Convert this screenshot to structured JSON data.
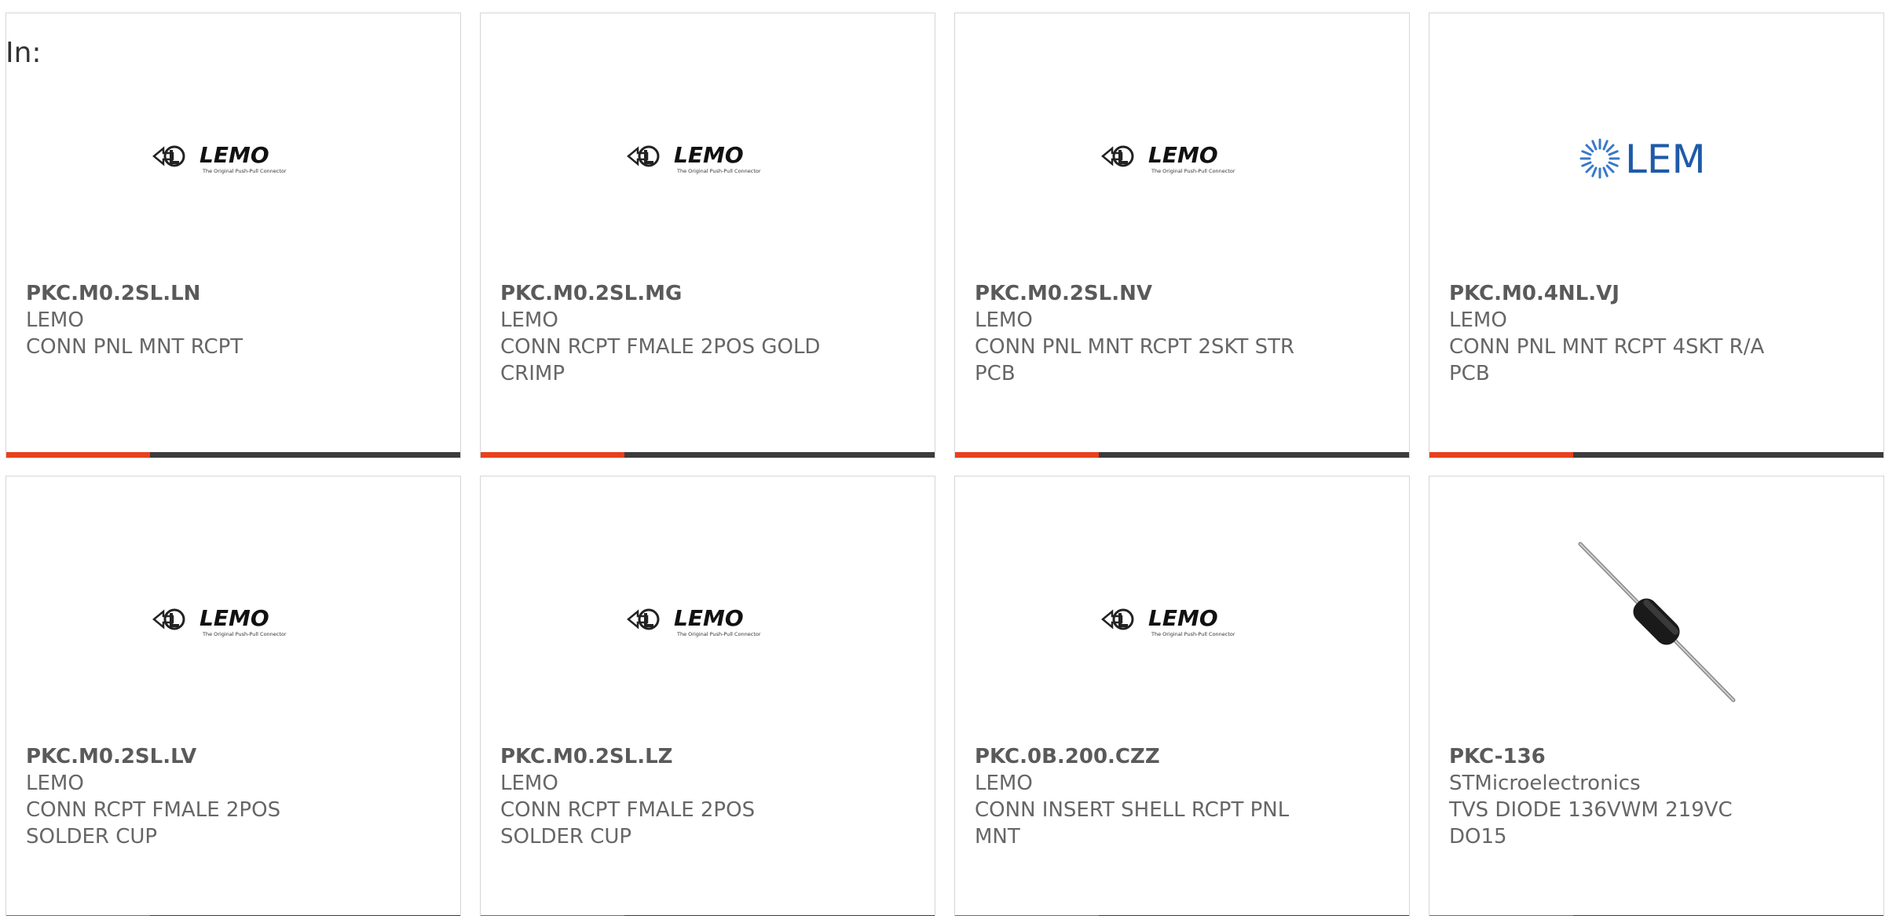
{
  "header": {
    "label": "In:"
  },
  "cards": [
    {
      "part": "PKC.M0.2SL.LN",
      "manufacturer": "LEMO",
      "description": "CONN PNL MNT RCPT",
      "description2": "",
      "image": "lemo-logo",
      "logo_text": "LEMO",
      "logo_tagline": "The Original Push-Pull Connector"
    },
    {
      "part": "PKC.M0.2SL.MG",
      "manufacturer": "LEMO",
      "description": "CONN RCPT FMALE 2POS GOLD",
      "description2": "CRIMP",
      "image": "lemo-logo",
      "logo_text": "LEMO",
      "logo_tagline": "The Original Push-Pull Connector"
    },
    {
      "part": "PKC.M0.2SL.NV",
      "manufacturer": "LEMO",
      "description": "CONN PNL MNT RCPT 2SKT STR",
      "description2": "PCB",
      "image": "lemo-logo",
      "logo_text": "LEMO",
      "logo_tagline": "The Original Push-Pull Connector"
    },
    {
      "part": "PKC.M0.4NL.VJ",
      "manufacturer": "LEMO",
      "description": "CONN PNL MNT RCPT 4SKT R/A",
      "description2": "PCB",
      "image": "lem-logo",
      "logo_text": "LEM"
    },
    {
      "part": "PKC.M0.2SL.LV",
      "manufacturer": "LEMO",
      "description": "CONN RCPT FMALE 2POS",
      "description2": "SOLDER CUP",
      "image": "lemo-logo",
      "logo_text": "LEMO",
      "logo_tagline": "The Original Push-Pull Connector"
    },
    {
      "part": "PKC.M0.2SL.LZ",
      "manufacturer": "LEMO",
      "description": "CONN RCPT FMALE 2POS",
      "description2": "SOLDER CUP",
      "image": "lemo-logo",
      "logo_text": "LEMO",
      "logo_tagline": "The Original Push-Pull Connector"
    },
    {
      "part": "PKC.0B.200.CZZ",
      "manufacturer": "LEMO",
      "description": "CONN INSERT SHELL RCPT PNL",
      "description2": "MNT",
      "image": "lemo-logo",
      "logo_text": "LEMO",
      "logo_tagline": "The Original Push-Pull Connector"
    },
    {
      "part": "PKC-136",
      "manufacturer": "STMicroelectronics",
      "description": "TVS DIODE 136VWM 219VC",
      "description2": "DO15",
      "image": "diode-photo"
    }
  ],
  "colors": {
    "accent": "#e8401c",
    "bar": "#3c3c3c",
    "border": "#d6d6d6",
    "text": "#666666",
    "lem_blue": "#1e5aa8"
  }
}
